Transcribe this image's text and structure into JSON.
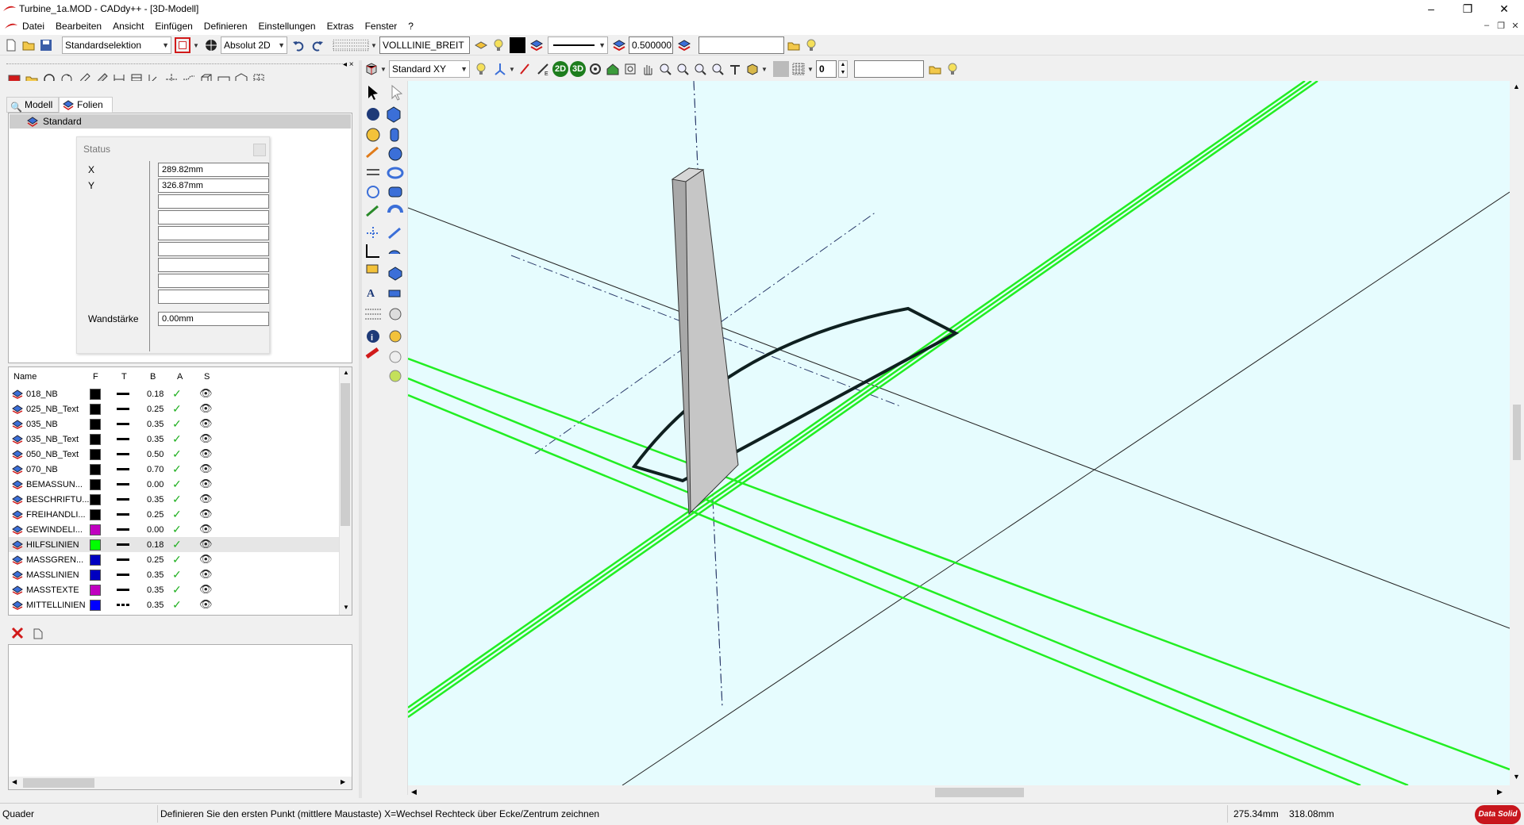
{
  "window": {
    "title": "Turbine_1a.MOD  -  CADdy++ - [3D-Modell]",
    "controls": [
      "–",
      "❐",
      "✕"
    ],
    "mdi_controls": [
      "–",
      "❐",
      "✕"
    ]
  },
  "menu": [
    "Datei",
    "Bearbeiten",
    "Ansicht",
    "Einfügen",
    "Definieren",
    "Einstellungen",
    "Extras",
    "Fenster",
    "?"
  ],
  "toolbar1": {
    "selection_mode": "Standardselektion",
    "coord_mode": "Absolut 2D",
    "line_type": "VOLLLINIE_BREIT",
    "line_width": "0.500000",
    "search_value": ""
  },
  "toolbar2": {
    "view": "Standard XY",
    "btn_2d": "2D",
    "btn_3d": "3D",
    "counter": "0",
    "search_value": ""
  },
  "tabs": [
    {
      "label": "Modell",
      "active": false
    },
    {
      "label": "Folien",
      "active": true
    }
  ],
  "folie_root": "Standard",
  "status": {
    "title": "Status",
    "x_label": "X",
    "x_value": "289.82mm",
    "y_label": "Y",
    "y_value": "326.87mm",
    "wall_label": "Wandstärke",
    "wall_value": "0.00mm"
  },
  "layer_headers": [
    "Name",
    "F",
    "T",
    "B",
    "A",
    "S"
  ],
  "layers": [
    {
      "name": "018_NB",
      "color": "#000000",
      "width": "0.18",
      "line": "solid"
    },
    {
      "name": "025_NB_Text",
      "color": "#000000",
      "width": "0.25",
      "line": "solid"
    },
    {
      "name": "035_NB",
      "color": "#000000",
      "width": "0.35",
      "line": "solid"
    },
    {
      "name": "035_NB_Text",
      "color": "#000000",
      "width": "0.35",
      "line": "solid"
    },
    {
      "name": "050_NB_Text",
      "color": "#000000",
      "width": "0.50",
      "line": "solid"
    },
    {
      "name": "070_NB",
      "color": "#000000",
      "width": "0.70",
      "line": "solid"
    },
    {
      "name": "BEMASSUN...",
      "color": "#000000",
      "width": "0.00",
      "line": "solid"
    },
    {
      "name": "BESCHRIFTU...",
      "color": "#000000",
      "width": "0.35",
      "line": "solid"
    },
    {
      "name": "FREIHANDLI...",
      "color": "#000000",
      "width": "0.25",
      "line": "solid"
    },
    {
      "name": "GEWINDELI...",
      "color": "#c000c0",
      "width": "0.00",
      "line": "solid"
    },
    {
      "name": "HILFSLINIEN",
      "color": "#00ff00",
      "width": "0.18",
      "line": "solid",
      "selected": true
    },
    {
      "name": "MASSGREN...",
      "color": "#0000c0",
      "width": "0.25",
      "line": "solid"
    },
    {
      "name": "MASSLINIEN",
      "color": "#0000c0",
      "width": "0.35",
      "line": "solid"
    },
    {
      "name": "MASSTEXTE",
      "color": "#c000c0",
      "width": "0.35",
      "line": "solid"
    },
    {
      "name": "MITTELLINIEN",
      "color": "#0000ff",
      "width": "0.35",
      "line": "dash"
    }
  ],
  "statusbar": {
    "command": "Quader",
    "prompt": "Definieren Sie den ersten Punkt (mittlere Maustaste) X=Wechsel Rechteck über Ecke/Zentrum zeichnen",
    "coord_x": "275.34mm",
    "coord_y": "318.08mm",
    "brand": "Data Solid"
  },
  "colors": {
    "viewport_bg": "#e6fcfe",
    "guide_green": "#22ee22",
    "accent_red": "#d11a1a"
  }
}
